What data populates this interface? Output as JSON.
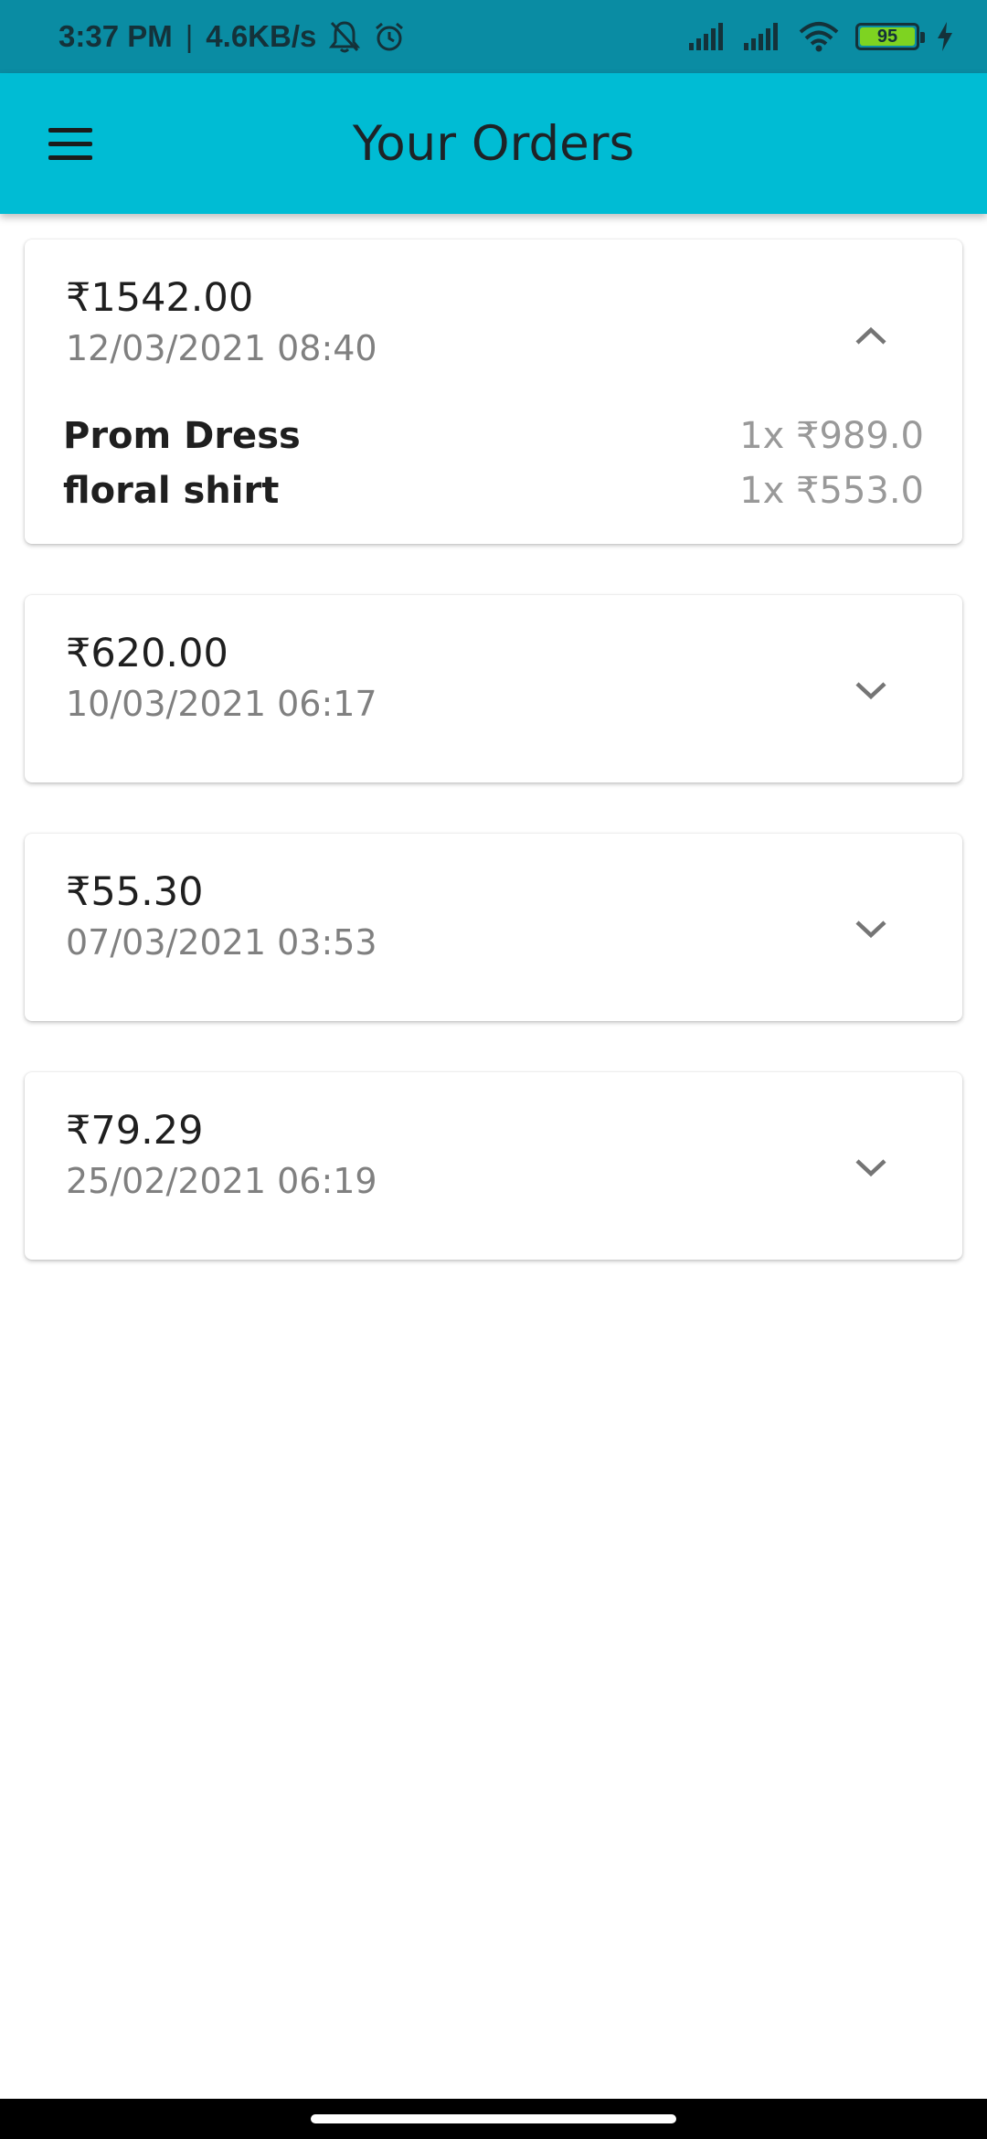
{
  "status_bar": {
    "time": "3:37 PM",
    "separator": "|",
    "network_speed": "4.6KB/s",
    "battery_level": "95",
    "icons": [
      "bell-muted-icon",
      "alarm-icon",
      "signal-icon",
      "signal-icon",
      "wifi-icon",
      "battery-icon",
      "charging-icon"
    ]
  },
  "app_bar": {
    "title": "Your Orders",
    "menu_icon": "hamburger-menu-icon",
    "background": "#00bcd4"
  },
  "orders": [
    {
      "amount": "₹1542.00",
      "date": "12/03/2021 08:40",
      "expanded": true,
      "items": [
        {
          "name": "Prom Dress",
          "qty_price": "1x ₹989.0"
        },
        {
          "name": "floral shirt",
          "qty_price": "1x ₹553.0"
        }
      ]
    },
    {
      "amount": "₹620.00",
      "date": "10/03/2021 06:17",
      "expanded": false
    },
    {
      "amount": "₹55.30",
      "date": "07/03/2021 03:53",
      "expanded": false
    },
    {
      "amount": "₹79.29",
      "date": "25/02/2021 06:19",
      "expanded": false
    }
  ]
}
